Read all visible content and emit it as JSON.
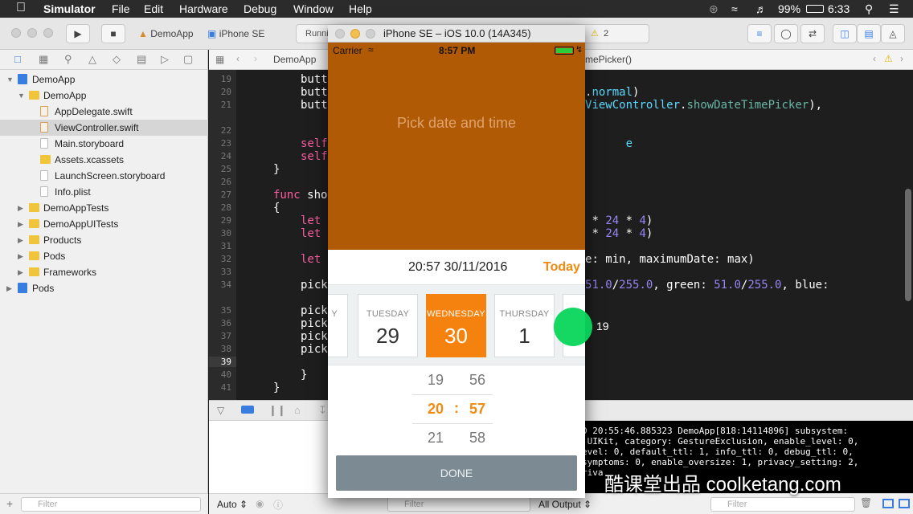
{
  "menubar": {
    "app": "Simulator",
    "items": [
      "File",
      "Edit",
      "Hardware",
      "Debug",
      "Window",
      "Help"
    ],
    "battery": "99%",
    "clock": "6:33"
  },
  "toolbar": {
    "scheme": "DemoApp",
    "device": "iPhone SE",
    "activity": "Runni",
    "warnings": "2"
  },
  "navigator": {
    "items": [
      {
        "label": "DemoApp",
        "kind": "project",
        "depth": 0,
        "open": true
      },
      {
        "label": "DemoApp",
        "kind": "folder",
        "depth": 1,
        "open": true
      },
      {
        "label": "AppDelegate.swift",
        "kind": "swift",
        "depth": 2
      },
      {
        "label": "ViewController.swift",
        "kind": "swift",
        "depth": 2,
        "selected": true
      },
      {
        "label": "Main.storyboard",
        "kind": "file",
        "depth": 2
      },
      {
        "label": "Assets.xcassets",
        "kind": "folder",
        "depth": 2
      },
      {
        "label": "LaunchScreen.storyboard",
        "kind": "file",
        "depth": 2
      },
      {
        "label": "Info.plist",
        "kind": "file",
        "depth": 2
      },
      {
        "label": "DemoAppTests",
        "kind": "folder",
        "depth": 1
      },
      {
        "label": "DemoAppUITests",
        "kind": "folder",
        "depth": 1
      },
      {
        "label": "Products",
        "kind": "folder",
        "depth": 1
      },
      {
        "label": "Pods",
        "kind": "folder",
        "depth": 1
      },
      {
        "label": "Frameworks",
        "kind": "folder",
        "depth": 1
      },
      {
        "label": "Pods",
        "kind": "project",
        "depth": 0
      }
    ],
    "filter_placeholder": "Filter"
  },
  "editor": {
    "jump_left": "DemoApp",
    "jump_right": "mePicker()",
    "line_numbers": [
      "19",
      "20",
      "21",
      "22",
      "23",
      "24",
      "25",
      "26",
      "27",
      "28",
      "29",
      "30",
      "31",
      "32",
      "33",
      "34",
      "35",
      "36",
      "37",
      "38",
      "39",
      "40",
      "41"
    ]
  },
  "console": {
    "lines": [
      "0 20:55:46.885323 DemoApp[818:14114896] subsystem:",
      ".UIKit, category: GestureExclusion, enable_level: 0,",
      "evel: 0, default_ttl: 1, info_ttl: 0, debug_ttl: 0,",
      "symptoms: 0, enable_oversize: 1, privacy_setting: 2,",
      "riva"
    ],
    "auto_label": "Auto",
    "output_label": "All Output",
    "filter_placeholder": "Filter"
  },
  "simulator": {
    "title": "iPhone SE – iOS 10.0 (14A345)",
    "status": {
      "carrier": "Carrier",
      "time": "8:57 PM"
    },
    "pick_label": "Pick date and time",
    "selected_datetime": "20:57 30/11/2016",
    "today_label": "Today",
    "days": [
      {
        "name": "Y",
        "num": ""
      },
      {
        "name": "TUESDAY",
        "num": "29"
      },
      {
        "name": "WEDNESDAY",
        "num": "30"
      },
      {
        "name": "THURSDAY",
        "num": "1"
      }
    ],
    "touch_label": "19",
    "hours": [
      "19",
      "20",
      "21"
    ],
    "minutes": [
      "56",
      "57",
      "58"
    ],
    "separator": ":",
    "done_label": "DONE"
  },
  "watermark": "酷课堂出品 coolketang.com",
  "colors": {
    "header": "#b15a06",
    "accent": "#f5820f",
    "done": "#7b8a93",
    "touch": "#08d65a"
  }
}
